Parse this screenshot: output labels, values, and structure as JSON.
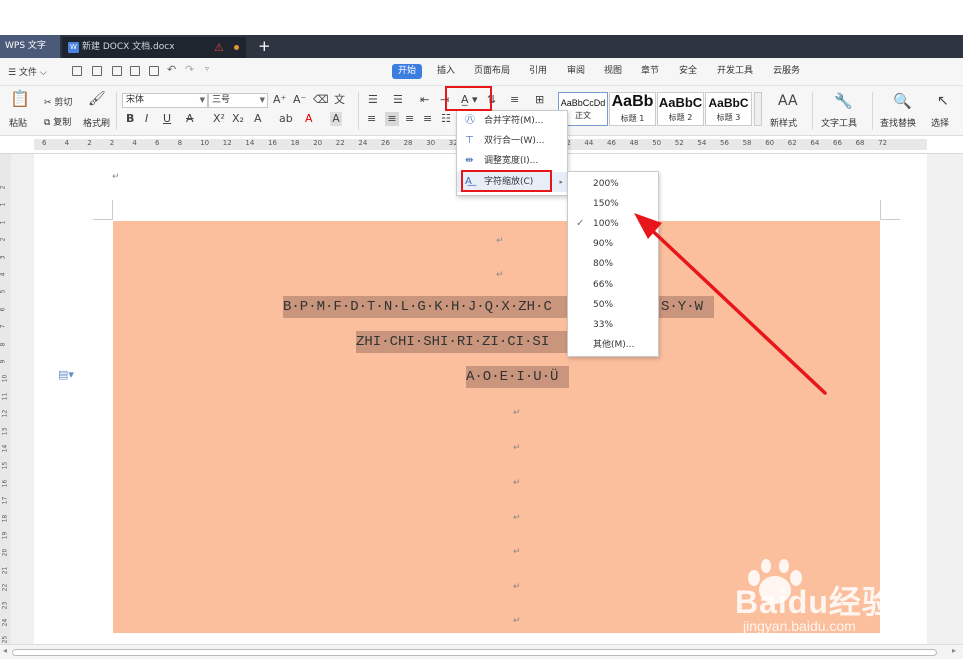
{
  "titlebar": {
    "app_name": "WPS 文字",
    "doc_tab": "新建 DOCX 文档.docx",
    "new_tab": "+"
  },
  "menu": {
    "file_label": "文件",
    "tabs": [
      "开始",
      "插入",
      "页面布局",
      "引用",
      "审阅",
      "视图",
      "章节",
      "安全",
      "开发工具",
      "云服务"
    ],
    "active_tab": "开始"
  },
  "ribbon": {
    "paste": "粘贴",
    "cut": "剪切",
    "copy": "复制",
    "format_painter": "格式刷",
    "font_name": "宋体",
    "font_size": "三号",
    "styles": [
      {
        "preview": "AaBbCcDd",
        "caption": "正文"
      },
      {
        "preview": "AaBb",
        "caption": "标题 1"
      },
      {
        "preview": "AaBbC",
        "caption": "标题 2"
      },
      {
        "preview": "AaBbC",
        "caption": "标题 3"
      }
    ],
    "new_style": "新样式",
    "text_tools": "文字工具",
    "find_replace": "查找替换",
    "select": "选择"
  },
  "ruler": {
    "ticks": [
      "6",
      "4",
      "2",
      "2",
      "4",
      "6",
      "8",
      "10",
      "12",
      "14",
      "16",
      "18",
      "20",
      "22",
      "24",
      "26",
      "28",
      "30",
      "32",
      "34",
      "36",
      "38",
      "40",
      "42",
      "44",
      "46",
      "48",
      "50",
      "52",
      "54",
      "56",
      "58",
      "60",
      "62",
      "64",
      "66",
      "68",
      "72"
    ],
    "vticks": [
      "2",
      "1",
      "1",
      "2",
      "3",
      "4",
      "5",
      "6",
      "7",
      "8",
      "9",
      "10",
      "11",
      "12",
      "13",
      "14",
      "15",
      "16",
      "17",
      "18",
      "19",
      "20",
      "21",
      "22",
      "23",
      "24",
      "25"
    ]
  },
  "document": {
    "line1": "B·P·M·F·D·T·N·L·G·K·H·J·Q·X·ZH·C",
    "line1_tail": "S·Y·W",
    "line2": "ZHI·CHI·SHI·RI·ZI·CI·SI",
    "line3": "A·O·E·I·U·Ü",
    "para_mark": "↵"
  },
  "menus": {
    "menu1": [
      "合并字符(M)...",
      "双行合一(W)...",
      "调整宽度(I)...",
      "字符缩放(C)"
    ],
    "menu2": [
      "200%",
      "150%",
      "100%",
      "90%",
      "80%",
      "66%",
      "50%",
      "33%",
      "其他(M)..."
    ],
    "checked": "100%"
  },
  "watermark": {
    "brand": "Baidu经验",
    "url": "jingyan.baidu.com"
  },
  "colors": {
    "title_bar": "#2e3440",
    "accent": "#3c7ee0",
    "highlight_box": "#e8161a",
    "page_shading": "#fbbf9e",
    "text_highlight": "#c9957c"
  }
}
